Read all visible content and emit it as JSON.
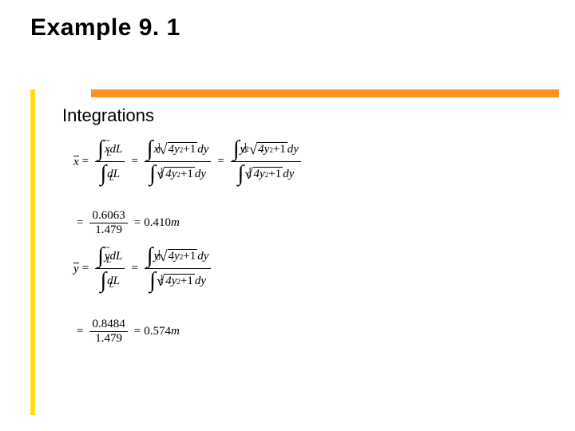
{
  "title": "Example 9. 1",
  "subheading": "Integrations",
  "sym": {
    "xbar": "x",
    "ybar": "y",
    "xtilde": "x",
    "ytilde": "y",
    "dL": "dL",
    "L": "L",
    "eq": "=",
    "int": "∫",
    "rad": "√",
    "zero": "0",
    "one": "1",
    "x": "x",
    "y": "y",
    "dy": "dy",
    "m": "m"
  },
  "expr": {
    "fourY2": "4y",
    "plus1": "+1",
    "sqExp": "2"
  },
  "vals": {
    "xnum": "0.6063",
    "xden": "1.479",
    "xres": "0.410",
    "ynum": "0.8484",
    "yden": "1.479",
    "yres": "0.574"
  }
}
